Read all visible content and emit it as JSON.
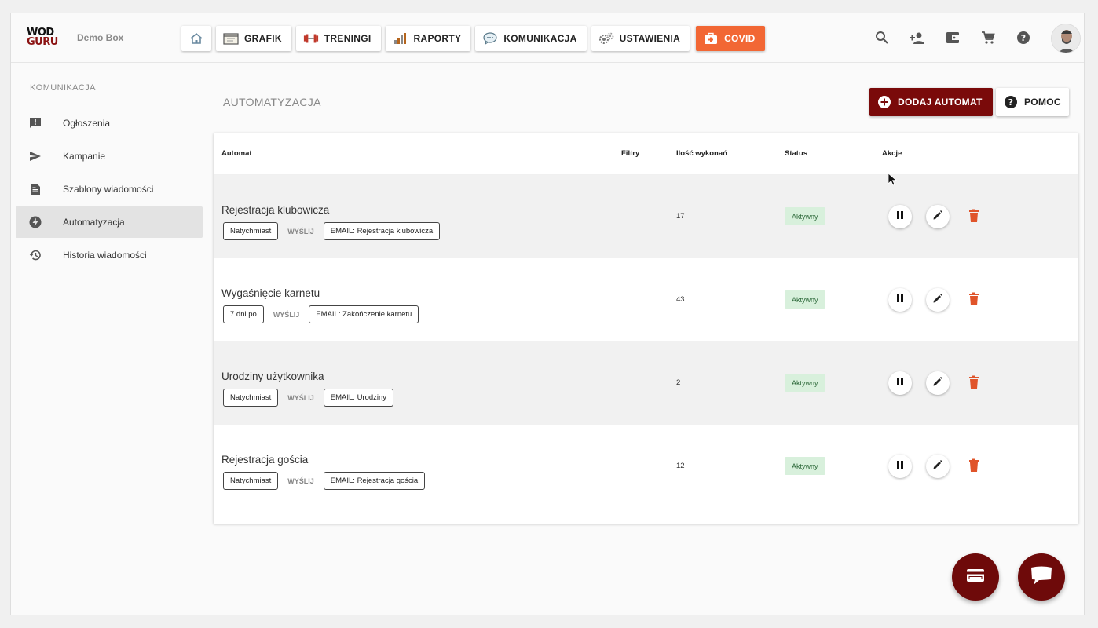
{
  "header": {
    "logo_line1": "WOD",
    "logo_line2": "GURU",
    "box_name": "Demo Box",
    "nav": [
      {
        "label": "",
        "icon": "home-icon"
      },
      {
        "label": "GRAFIK",
        "icon": "calendar-icon"
      },
      {
        "label": "TRENINGI",
        "icon": "dumbbell-icon"
      },
      {
        "label": "RAPORTY",
        "icon": "bar-chart-icon"
      },
      {
        "label": "KOMUNIKACJA",
        "icon": "chat-bubble-icon"
      },
      {
        "label": "USTAWIENIA",
        "icon": "gears-icon"
      },
      {
        "label": "COVID",
        "icon": "first-aid-icon"
      }
    ],
    "right_icons": [
      "search-icon",
      "add-person-icon",
      "wallet-icon",
      "cart-icon",
      "help-icon"
    ]
  },
  "sidebar": {
    "title": "KOMUNIKACJA",
    "items": [
      {
        "label": "Ogłoszenia",
        "icon": "announcement-icon"
      },
      {
        "label": "Kampanie",
        "icon": "send-icon"
      },
      {
        "label": "Szablony wiadomości",
        "icon": "document-icon"
      },
      {
        "label": "Automatyzacja",
        "icon": "bolt-icon",
        "active": true
      },
      {
        "label": "Historia wiadomości",
        "icon": "history-icon"
      }
    ]
  },
  "main": {
    "title": "AUTOMATYZACJA",
    "add_button": "DODAJ AUTOMAT",
    "help_button": "POMOC",
    "columns": {
      "automat": "Automat",
      "filtry": "Filtry",
      "ilosc": "Ilość wykonań",
      "status": "Status",
      "akcje": "Akcje"
    },
    "send_label": "WYŚLIJ",
    "rows": [
      {
        "name": "Rejestracja klubowicza",
        "timing": "Natychmiast",
        "action": "EMAIL: Rejestracja klubowicza",
        "count": "17",
        "status": "Aktywny"
      },
      {
        "name": "Wygaśnięcie karnetu",
        "timing": "7 dni po",
        "action": "EMAIL: Zakończenie karnetu",
        "count": "43",
        "status": "Aktywny"
      },
      {
        "name": "Urodziny użytkownika",
        "timing": "Natychmiast",
        "action": "EMAIL: Urodziny",
        "count": "2",
        "status": "Aktywny"
      },
      {
        "name": "Rejestracja gościa",
        "timing": "Natychmiast",
        "action": "EMAIL: Rejestracja gościa",
        "count": "12",
        "status": "Aktywny"
      }
    ]
  },
  "colors": {
    "brand": "#7a0a0a",
    "covid": "#f26734",
    "trash": "#e0542a",
    "status_bg": "#d8f0dc"
  }
}
